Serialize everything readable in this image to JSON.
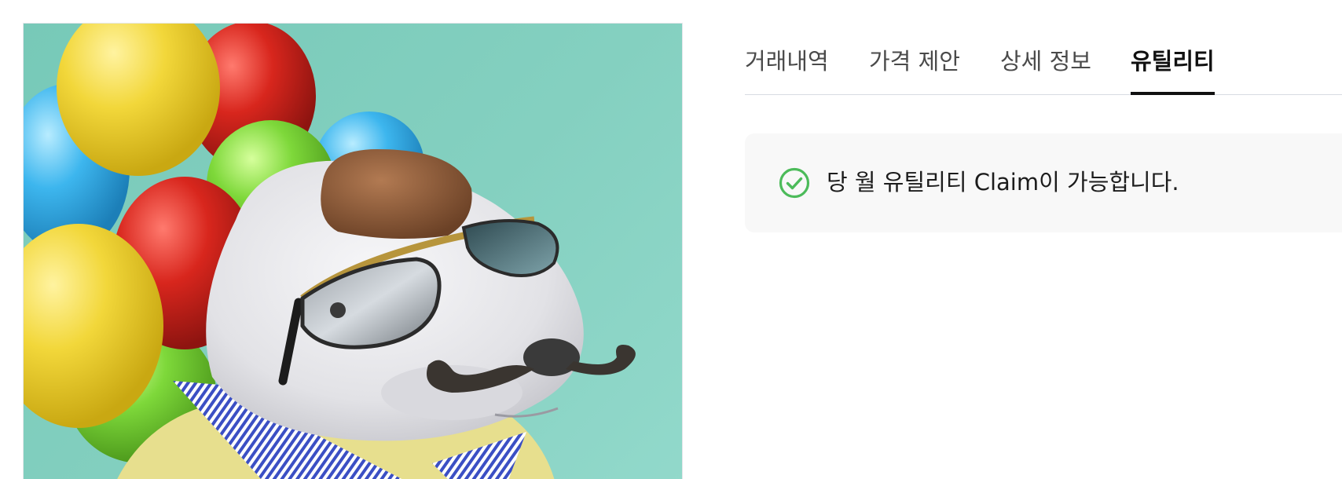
{
  "tabs": [
    {
      "label": "거래내역",
      "active": false
    },
    {
      "label": "가격 제안",
      "active": false
    },
    {
      "label": "상세 정보",
      "active": false
    },
    {
      "label": "유틸리티",
      "active": true
    }
  ],
  "notice": {
    "icon": "check-circle-icon",
    "icon_color": "#4cbb5a",
    "message": "당 월 유틸리티 Claim이 가능합니다."
  },
  "artwork": {
    "background_color": "#84d0c0"
  }
}
